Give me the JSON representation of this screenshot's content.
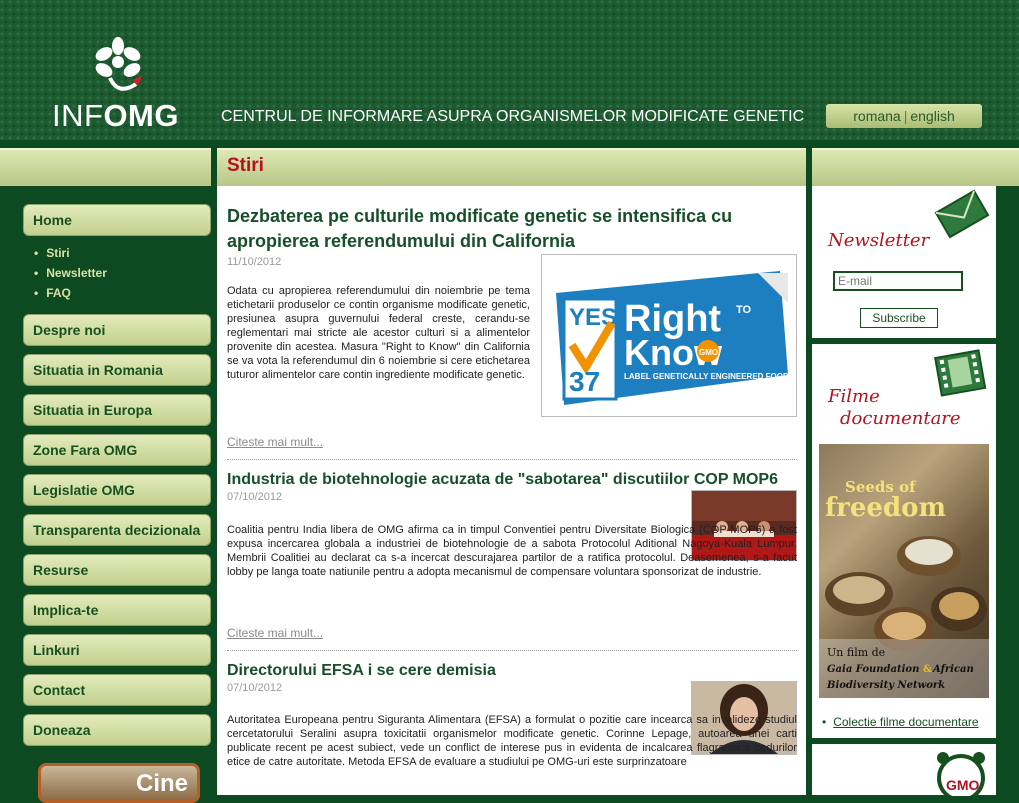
{
  "header": {
    "logo_text_light": "INF",
    "logo_text_bold": "OMG",
    "tagline": "CENTRUL DE INFORMARE ASUPRA ORGANISMELOR MODIFICATE GENETIC",
    "lang_romana": "romana",
    "lang_separator": "|",
    "lang_english": "english"
  },
  "section_title": "Stiri",
  "nav": {
    "items": [
      {
        "label": "Home"
      },
      {
        "label": "Despre noi"
      },
      {
        "label": "Situatia in Romania"
      },
      {
        "label": "Situatia in Europa"
      },
      {
        "label": "Zone Fara OMG"
      },
      {
        "label": "Legislatie OMG"
      },
      {
        "label": "Transparenta decizionala"
      },
      {
        "label": "Resurse"
      },
      {
        "label": "Implica-te"
      },
      {
        "label": "Linkuri"
      },
      {
        "label": "Contact"
      },
      {
        "label": "Doneaza"
      }
    ],
    "subitems": [
      {
        "label": "Stiri"
      },
      {
        "label": "Newsletter"
      },
      {
        "label": "FAQ"
      }
    ],
    "cine_label": "Cine"
  },
  "articles": [
    {
      "title_line1": "Dezbaterea pe culturile modificate genetic se intensifica cu",
      "title_line2": "apropierea referendumului din California",
      "date": "11/10/2012",
      "body": "Odata cu apropierea referendumului din noiembrie pe tema etichetarii produselor ce contin organisme modificate genetic, presiunea asupra guvernului federal creste, cerandu-se reglementari mai stricte ale acestor culturi si a alimentelor provenite din acestea. Masura \"Right to Know\" din California se va vota la referendumul din 6 noiembrie si cere etichetarea tuturor alimentelor care contin ingrediente modificate genetic.",
      "more": "Citeste mai mult...",
      "image": {
        "yes": "YES",
        "num": "37",
        "right": "Right",
        "to": "TO",
        "know": "Know",
        "gmo": "GMO",
        "caption": "LABEL GENETICALLY ENGINEERED FOODS"
      }
    },
    {
      "title": "Industria de biotehnologie acuzata de \"sabotarea\" discutiilor COP MOP6",
      "date": "07/10/2012",
      "body": "Coalitia pentru India libera de OMG afirma ca in timpul Conventiei pentru Diversitate Biologica (COP MOP6) a fost expusa incercarea globala a industriei de biotehnologie de a sabota Protocolul Aditional Nagoya-Kuala Lumpur. Membrii Coalitiei au declarat ca s-a incercat descurajarea partilor de a ratifica protocolul. Deasemenea, s-a facut lobby pe langa toate natiunile pentru a adopta mecanismul de compensare voluntara sponsorizat de industrie.",
      "more": "Citeste mai mult..."
    },
    {
      "title": "Directorului EFSA i se cere demisia",
      "date": "07/10/2012",
      "body": "Autoritatea Europeana pentru Siguranta Alimentara (EFSA) a formulat o pozitie care incearca sa invalideze studiul cercetatorului Seralini asupra toxicitatii organismelor modificate genetic. Corinne Lepage, autoarea unei carti publicate recent pe acest subiect, vede un conflict de interese pus in evidenta de incalcarea flagranta a codurilor etice de catre autoritate. Metoda EFSA de evaluare a studiului pe OMG-uri este surprinzatoare"
    }
  ],
  "sidebar": {
    "newsletter_title": "Newsletter",
    "email_placeholder": "E-mail",
    "subscribe_label": "Subscribe",
    "films_title_line1": "Filme",
    "films_title_line2": "documentare",
    "poster": {
      "title_line1": "Seeds of",
      "title_line2": "freedom",
      "credit_line1": "Un film de",
      "credit_line2a": "Gaia Foundation",
      "credit_amp": "&",
      "credit_line2b": "African",
      "credit_line3": "Biodiversity Network"
    },
    "doc_link": "Colectie filme documentare",
    "gmo_badge": "GMO"
  },
  "colors": {
    "dark_green": "#0d4a22",
    "nav_text": "#17501f",
    "accent_red": "#b3121e",
    "band_light": "#dfe8b4"
  }
}
